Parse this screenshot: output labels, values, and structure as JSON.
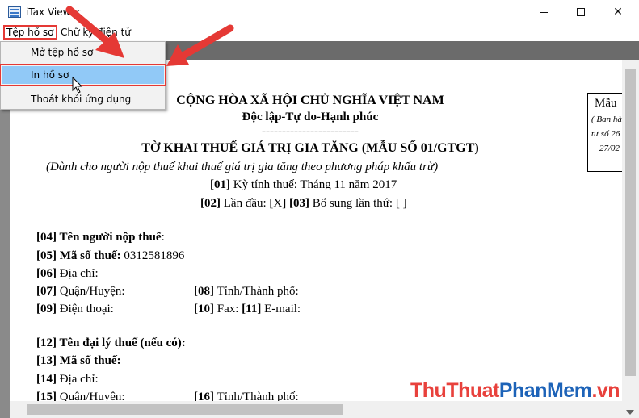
{
  "window": {
    "title": "iTax Viewer",
    "minimize_icon": "minimize-icon",
    "maximize_icon": "maximize-icon",
    "close_glyph": "✕"
  },
  "menubar": {
    "file": "Tệp hồ sơ",
    "sign": "Chữ ký điện tử"
  },
  "dropdown": {
    "open": "Mở tệp hồ sơ",
    "print": "In hồ sơ",
    "exit": "Thoát khỏi ứng dụng"
  },
  "document": {
    "nation": "CỘNG HÒA XÃ HỘI CHỦ NGHĨA VIỆT NAM",
    "motto": "Độc lập-Tự do-Hạnh phúc",
    "separator": "------------------------",
    "form_title": "TỜ KHAI THUẾ GIÁ TRỊ GIA TĂNG (MẪU SỐ 01/GTGT)",
    "form_subtitle": "(Dành cho người nộp thuế khai thuế giá trị gia tăng theo phương pháp khấu trừ)",
    "period_code": "[01]",
    "period_text": "Kỳ tính thuế: Tháng 11 năm 2017",
    "first_code": "[02]",
    "first_text": "Lần đầu: [X]",
    "supp_code": "[03]",
    "supp_text": "Bổ sung lần thứ: [ ]",
    "f04": "[04] Tên người nộp thuế",
    "f04_tail": ":",
    "f05": "[05] Mã số thuế:",
    "f05_value": "0312581896",
    "f06_code": "[06]",
    "f06_text": "Địa chỉ:",
    "f07_code": "[07]",
    "f07_text": "Quận/Huyện:",
    "f08_code": "[08]",
    "f08_text": "Tỉnh/Thành phố:",
    "f09_code": "[09]",
    "f09_text": "Điện thoại:",
    "f10_code": "[10]",
    "f10_text": "Fax:",
    "f11_code": "[11]",
    "f11_text": "E-mail:",
    "f12": "[12] Tên đại lý thuế (nếu có):",
    "f13": "[13] Mã số thuế:",
    "f14_code": "[14]",
    "f14_text": "Địa chỉ:",
    "f15_code": "[15]",
    "f15_text": "Quận/Huyện:",
    "f16_code": "[16]",
    "f16_text": "Tỉnh/Thành phố:",
    "box_title": "Mẫu",
    "box_line1": "( Ban hà",
    "box_line2": "tư số 26",
    "box_line3": "27/02"
  },
  "watermark": {
    "part1": "ThuThuat",
    "part2": "PhanMem",
    "part3": ".vn"
  },
  "colors": {
    "annotation_red": "#e53935",
    "highlight_blue": "#91c9f7"
  }
}
